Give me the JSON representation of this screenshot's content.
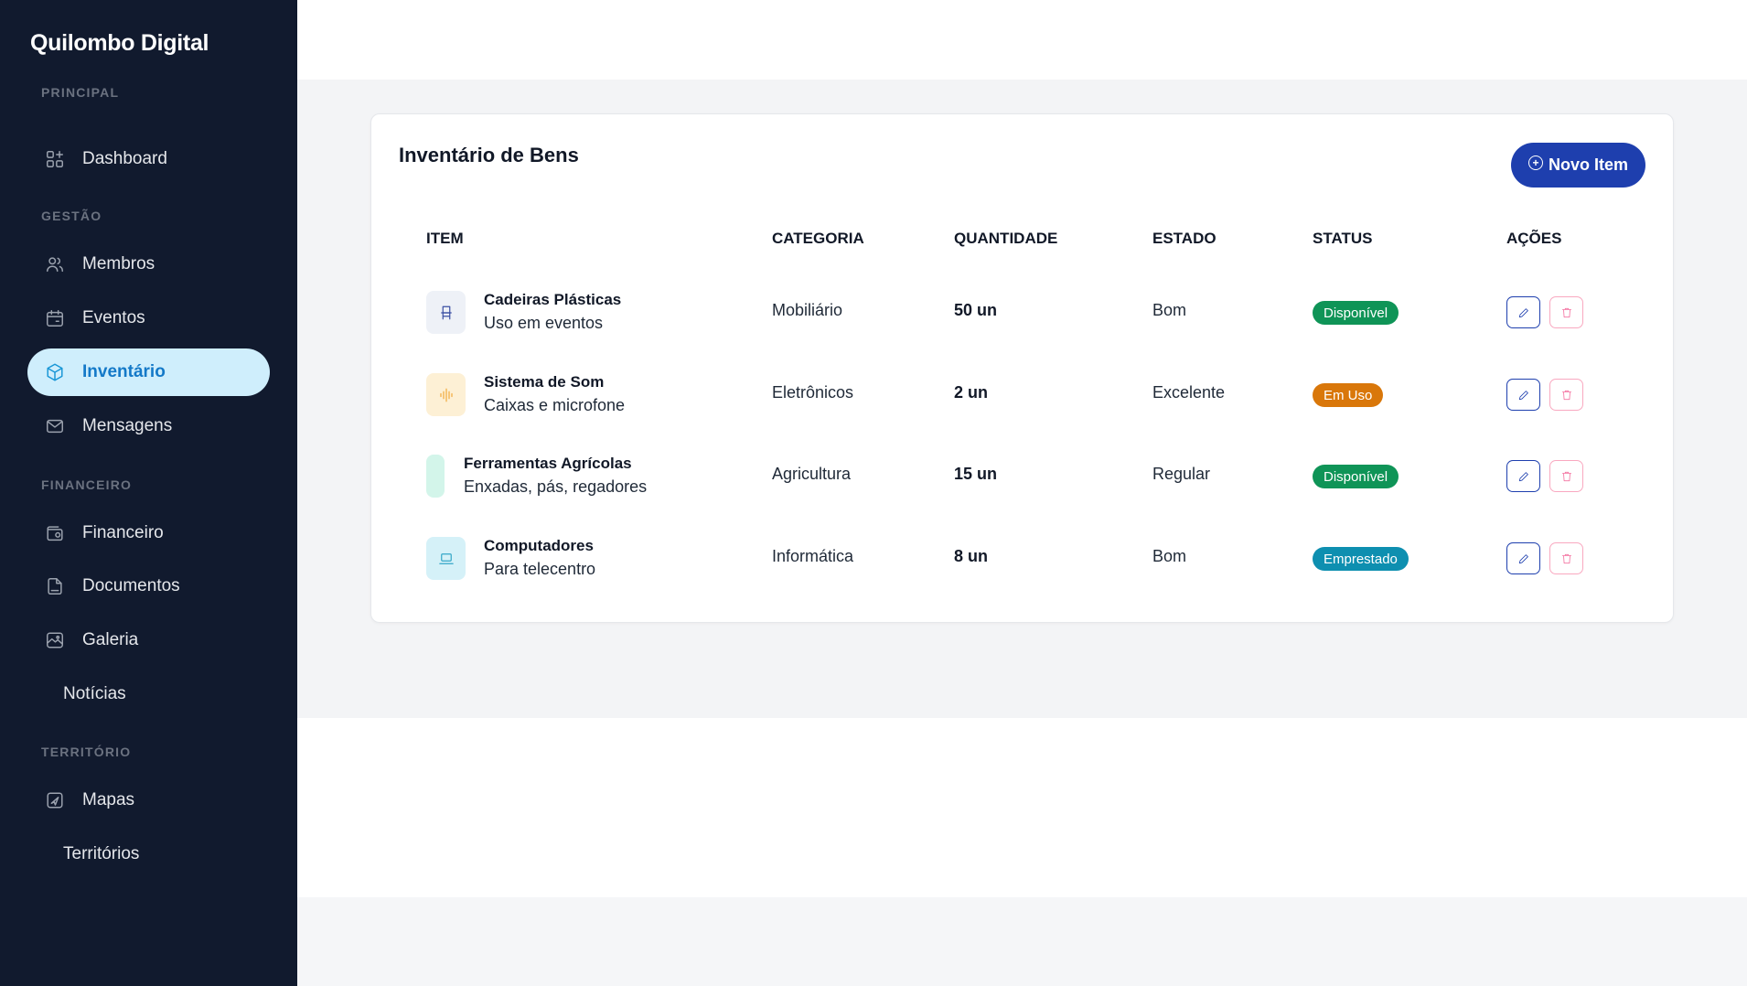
{
  "sidebar": {
    "brand": "Quilombo Digital",
    "sections": {
      "principal": "PRINCIPAL",
      "gestao": "GESTÃO",
      "financeiro": "FINANCEIRO",
      "territorio": "TERRITÓRIO"
    },
    "items": [
      {
        "label": "Dashboard",
        "icon": "dashboard-icon"
      },
      {
        "label": "Membros",
        "icon": "users-icon"
      },
      {
        "label": "Eventos",
        "icon": "calendar-icon"
      },
      {
        "label": "Inventário",
        "icon": "box-icon",
        "active": true
      },
      {
        "label": "Mensagens",
        "icon": "mail-icon"
      },
      {
        "label": "Financeiro",
        "icon": "wallet-icon"
      },
      {
        "label": "Documentos",
        "icon": "document-icon"
      },
      {
        "label": "Galeria",
        "icon": "gallery-icon"
      },
      {
        "label": "Notícias",
        "icon": ""
      },
      {
        "label": "Mapas",
        "icon": "map-icon"
      },
      {
        "label": "Territórios",
        "icon": ""
      }
    ]
  },
  "card": {
    "title": "Inventário de Bens",
    "new_button": "Novo Item"
  },
  "table": {
    "headers": [
      "ITEM",
      "CATEGORIA",
      "QUANTIDADE",
      "ESTADO",
      "STATUS",
      "AÇÕES"
    ],
    "rows": [
      {
        "name": "Cadeiras Plásticas",
        "desc": "Uso em eventos",
        "category": "Mobiliário",
        "quantity": "50 un",
        "state": "Bom",
        "status": "Disponível",
        "icon": "chair-icon"
      },
      {
        "name": "Sistema de Som",
        "desc": "Caixas e microfone",
        "category": "Eletrônicos",
        "quantity": "2 un",
        "state": "Excelente",
        "status": "Em Uso",
        "icon": "audio-icon"
      },
      {
        "name": "Ferramentas Agrícolas",
        "desc": "Enxadas, pás, regadores",
        "category": "Agricultura",
        "quantity": "15 un",
        "state": "Regular",
        "status": "Disponível",
        "icon": ""
      },
      {
        "name": "Computadores",
        "desc": "Para telecentro",
        "category": "Informática",
        "quantity": "8 un",
        "state": "Bom",
        "status": "Emprestado",
        "icon": "laptop-icon"
      }
    ]
  },
  "colors": {
    "sidebar_bg": "#111a2e",
    "accent": "#1e3fae",
    "active_nav_bg": "#cfeefc",
    "status_disponivel": "#0f9457",
    "status_em_uso": "#d9770a",
    "status_emprestado": "#0e8fb0",
    "delete_border": "#f9a8c0"
  }
}
